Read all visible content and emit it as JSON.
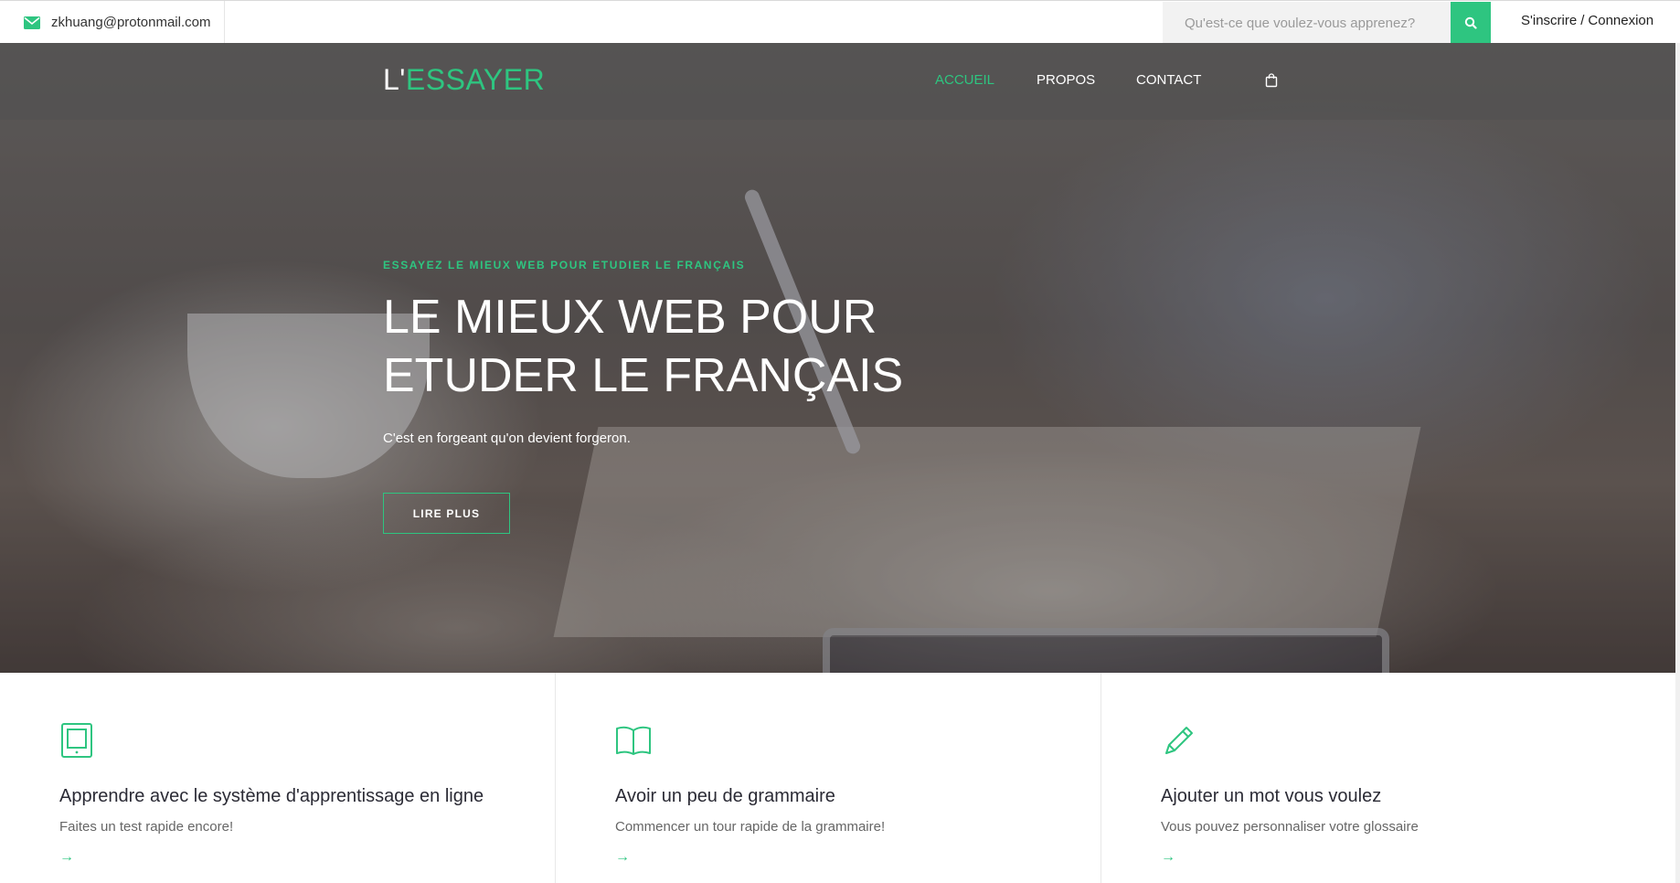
{
  "topbar": {
    "email": "zkhuang@protonmail.com",
    "search_placeholder": "Qu'est-ce que voulez-vous apprenez?",
    "signup_label": "S'inscrire",
    "separator": "/",
    "login_label": "Connexion"
  },
  "navbar": {
    "logo_prefix": "L'",
    "logo_rest": "ESSAYER",
    "items": [
      {
        "label": "ACCUEIL",
        "active": true
      },
      {
        "label": "PROPOS",
        "active": false
      },
      {
        "label": "CONTACT",
        "active": false
      }
    ],
    "cart_icon": "shopping-bag-icon"
  },
  "hero": {
    "kicker": "ESSAYEZ LE MIEUX WEB POUR ETUDIER LE FRANÇAIS",
    "title_line1": "LE MIEUX WEB POUR",
    "title_line2": "ETUDER LE FRANÇAIS",
    "subtitle": "C'est en forgeant qu'on devient forgeron.",
    "button_label": "LIRE PLUS"
  },
  "features": [
    {
      "icon": "tablet-icon",
      "title": "Apprendre avec le système d'apprentissage en ligne",
      "text": "Faites un test rapide encore!",
      "arrow": "→"
    },
    {
      "icon": "book-icon",
      "title": "Avoir un peu de grammaire",
      "text": "Commencer un tour rapide de la grammaire!",
      "arrow": "→"
    },
    {
      "icon": "pencil-icon",
      "title": "Ajouter un mot vous voulez",
      "text": "Vous pouvez personnaliser votre glossaire",
      "arrow": "→"
    }
  ],
  "colors": {
    "accent": "#2ec580",
    "text_dark": "#2b2b35",
    "text_muted": "#666666"
  }
}
